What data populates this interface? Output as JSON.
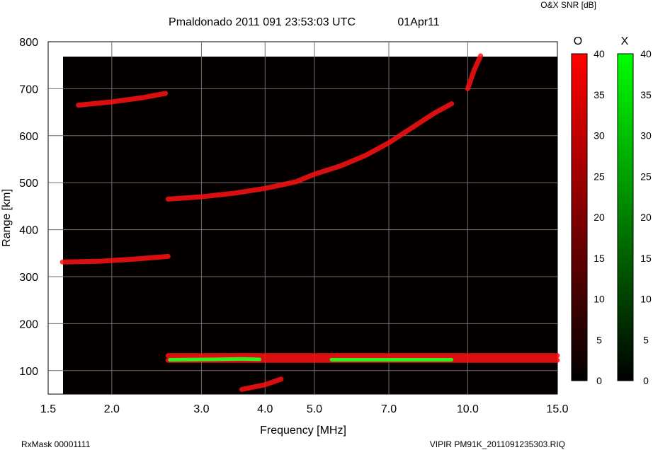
{
  "chart_data": {
    "type": "heatmap",
    "title": "Pmaldonado 2011 091 23:53:03 UTC",
    "date": "01Apr11",
    "xlabel": "Frequency [MHz]",
    "ylabel": "Range [km]",
    "x_scale": "log",
    "xlim": [
      1.5,
      15.0
    ],
    "ylim": [
      50,
      800
    ],
    "x_ticks": [
      1.5,
      2.0,
      3.0,
      4.0,
      5.0,
      7.0,
      10.0,
      15.0
    ],
    "x_tick_labels": [
      "1.5",
      "2.0",
      "3.0",
      "4.0",
      "5.0",
      "7.0",
      "10.0",
      "15.0"
    ],
    "y_ticks": [
      100,
      200,
      300,
      400,
      500,
      600,
      700,
      800
    ],
    "y_tick_labels": [
      "100",
      "200",
      "300",
      "400",
      "500",
      "600",
      "700",
      "800"
    ],
    "grid": true,
    "colorbar_title": "O&X SNR [dB]",
    "colorbars": [
      {
        "name": "O",
        "color": "#ff0000",
        "min": 0,
        "max": 40,
        "tick_labels": [
          "0",
          "5",
          "10",
          "15",
          "20",
          "25",
          "30",
          "35",
          "40"
        ]
      },
      {
        "name": "X",
        "color": "#00ff00",
        "min": 0,
        "max": 40,
        "tick_labels": [
          "0",
          "5",
          "10",
          "15",
          "20",
          "25",
          "30",
          "35",
          "40"
        ]
      }
    ],
    "traces": [
      {
        "mode": "O",
        "points": [
          [
            1.72,
            665
          ],
          [
            2.0,
            672
          ],
          [
            2.3,
            681
          ],
          [
            2.55,
            690
          ]
        ]
      },
      {
        "mode": "O",
        "points": [
          [
            1.6,
            331
          ],
          [
            1.9,
            333
          ],
          [
            2.2,
            337
          ],
          [
            2.58,
            343
          ]
        ]
      },
      {
        "mode": "O",
        "points": [
          [
            2.58,
            465
          ],
          [
            3.0,
            470
          ],
          [
            3.5,
            478
          ],
          [
            4.0,
            488
          ],
          [
            4.6,
            502
          ],
          [
            5.0,
            518
          ],
          [
            5.6,
            535
          ],
          [
            6.3,
            558
          ],
          [
            7.0,
            585
          ],
          [
            7.8,
            618
          ],
          [
            8.6,
            648
          ],
          [
            9.3,
            668
          ]
        ]
      },
      {
        "mode": "O",
        "points": [
          [
            2.58,
            132
          ],
          [
            4.0,
            132
          ],
          [
            6.0,
            132
          ],
          [
            8.0,
            132
          ],
          [
            10.0,
            132
          ],
          [
            12.0,
            132
          ],
          [
            15.0,
            132
          ]
        ]
      },
      {
        "mode": "O",
        "points": [
          [
            2.58,
            122
          ],
          [
            5.0,
            122
          ],
          [
            8.0,
            122
          ],
          [
            12.0,
            122
          ],
          [
            15.0,
            122
          ]
        ]
      },
      {
        "mode": "X",
        "points": [
          [
            2.6,
            123
          ],
          [
            3.2,
            124
          ],
          [
            3.6,
            125
          ],
          [
            3.9,
            124
          ]
        ]
      },
      {
        "mode": "X",
        "points": [
          [
            5.4,
            123
          ],
          [
            6.2,
            123
          ],
          [
            7.0,
            123
          ],
          [
            8.0,
            123
          ],
          [
            9.3,
            123
          ]
        ]
      },
      {
        "mode": "O",
        "points": [
          [
            3.6,
            60
          ],
          [
            4.0,
            70
          ],
          [
            4.3,
            82
          ]
        ]
      },
      {
        "mode": "O",
        "points": [
          [
            10.0,
            700
          ],
          [
            10.3,
            740
          ],
          [
            10.6,
            770
          ]
        ]
      }
    ]
  },
  "footer": {
    "rxmask": "RxMask 00001111",
    "file": "VIPIR  PM91K_2011091235303.RIQ"
  }
}
